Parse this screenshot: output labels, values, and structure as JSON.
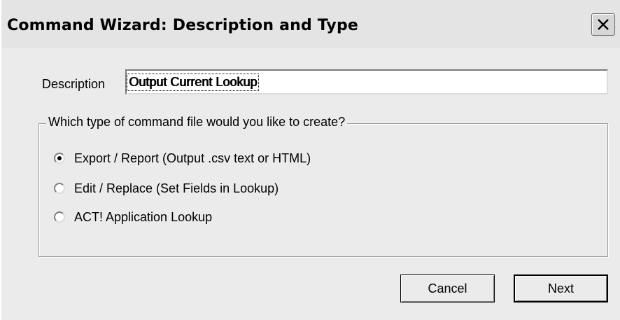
{
  "window": {
    "title": "Command Wizard: Description and Type"
  },
  "description": {
    "label": "Description",
    "value": "Output Current Lookup"
  },
  "type_group": {
    "legend": "Which type of command file would you like to create?",
    "options": [
      {
        "label": "Export / Report (Output .csv text or HTML)",
        "selected": true
      },
      {
        "label": "Edit / Replace (Set Fields in Lookup)",
        "selected": false
      },
      {
        "label": "ACT! Application Lookup",
        "selected": false
      }
    ]
  },
  "buttons": {
    "cancel_label": "Cancel",
    "next_label": "Next"
  },
  "icons": {
    "close": "close-icon"
  },
  "colors": {
    "window_bg": "#ebebeb",
    "titlebar_bg": "#e4e4e4"
  }
}
